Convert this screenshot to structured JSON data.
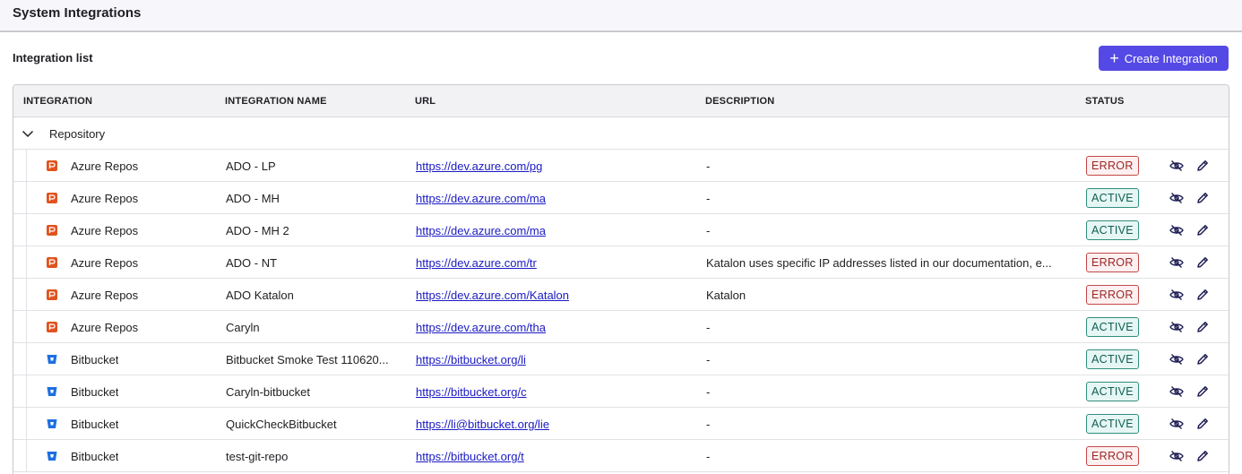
{
  "header": {
    "title": "System Integrations"
  },
  "section": {
    "title": "Integration list",
    "create_label": "Create Integration"
  },
  "table": {
    "columns": [
      "INTEGRATION",
      "INTEGRATION NAME",
      "URL",
      "DESCRIPTION",
      "STATUS"
    ],
    "group": {
      "label": "Repository"
    },
    "rows": [
      {
        "integration": "Azure Repos",
        "icon": "azure-repos-icon",
        "name": "ADO - LP",
        "url": "https://dev.azure.com/pg",
        "description": "-",
        "status": "ERROR"
      },
      {
        "integration": "Azure Repos",
        "icon": "azure-repos-icon",
        "name": "ADO - MH",
        "url": "https://dev.azure.com/ma",
        "description": "-",
        "status": "ACTIVE"
      },
      {
        "integration": "Azure Repos",
        "icon": "azure-repos-icon",
        "name": "ADO - MH 2",
        "url": "https://dev.azure.com/ma",
        "description": "-",
        "status": "ACTIVE"
      },
      {
        "integration": "Azure Repos",
        "icon": "azure-repos-icon",
        "name": "ADO - NT",
        "url": "https://dev.azure.com/tr",
        "description": "Katalon uses specific IP addresses listed in our documentation, e...",
        "status": "ERROR"
      },
      {
        "integration": "Azure Repos",
        "icon": "azure-repos-icon",
        "name": "ADO Katalon",
        "url": "https://dev.azure.com/Katalon",
        "description": "Katalon",
        "status": "ERROR"
      },
      {
        "integration": "Azure Repos",
        "icon": "azure-repos-icon",
        "name": "Caryln",
        "url": "https://dev.azure.com/tha",
        "description": "-",
        "status": "ACTIVE"
      },
      {
        "integration": "Bitbucket",
        "icon": "bitbucket-icon",
        "name": "Bitbucket Smoke Test 110620...",
        "url": "https://bitbucket.org/li",
        "description": "-",
        "status": "ACTIVE"
      },
      {
        "integration": "Bitbucket",
        "icon": "bitbucket-icon",
        "name": "Caryln-bitbucket",
        "url": "https://bitbucket.org/c",
        "description": "-",
        "status": "ACTIVE"
      },
      {
        "integration": "Bitbucket",
        "icon": "bitbucket-icon",
        "name": "QuickCheckBitbucket",
        "url": "https://li@bitbucket.org/lie",
        "description": "-",
        "status": "ACTIVE"
      },
      {
        "integration": "Bitbucket",
        "icon": "bitbucket-icon",
        "name": "test-git-repo",
        "url": "https://bitbucket.org/t",
        "description": "-",
        "status": "ERROR"
      }
    ]
  },
  "icons": {
    "row_actions": [
      "hide-eye-icon",
      "edit-pencil-icon"
    ],
    "group_toggle": "chevron-down-icon"
  },
  "colors": {
    "accent": "#5549e6",
    "active": "#0f5f53",
    "error": "#9b2626",
    "azure_icon": "#e0531f",
    "bitbucket_icon": "#1d6fe0"
  }
}
